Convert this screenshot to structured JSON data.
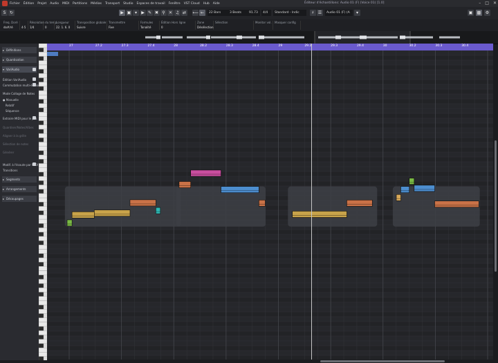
{
  "menu": {
    "items": [
      "Fichier",
      "Édition",
      "Projet",
      "Audio",
      "MIDI",
      "Partitions",
      "Médias",
      "Transport",
      "Studio",
      "Espaces de travail",
      "Fenêtre",
      "VST Cloud",
      "Hub",
      "Aide"
    ],
    "window_title": "Éditeur d'échantillons: Audio 01 (F) (Voice 01) [1.0]"
  },
  "toolbar": {
    "bars": "22 Bars",
    "beats": "3 Beats",
    "tempo": "91.73",
    "signature": "4/4",
    "scale": "Standard - Indic",
    "channel": "Audio 01 (F) (A"
  },
  "infoline": {
    "fields": [
      {
        "label": "Freq. Doré",
        "value": "do#/ré"
      },
      {
        "label": "",
        "value": "4·5"
      },
      {
        "label": "Résolution du temp",
        "value": "1/4"
      },
      {
        "label": "",
        "value": "0"
      },
      {
        "label": "Longueur",
        "value": "22. 1. 6. 0"
      },
      {
        "label": "Transposition globale",
        "value": "Suivre"
      },
      {
        "label": "Transmettre",
        "value": "Fixe"
      },
      {
        "label": "Formules",
        "value": "Tonalité"
      },
      {
        "label": "Édition Hors ligne",
        "value": "0"
      },
      {
        "label": "Zone",
        "value": "Désélection"
      },
      {
        "label": "Sélection",
        "value": ""
      },
      {
        "label": "Monitor vol.",
        "value": ""
      },
      {
        "label": "Masquer config",
        "value": ""
      }
    ]
  },
  "inspector": {
    "sections_top": [
      "Définitions",
      "Quantisation",
      "VariAudio"
    ],
    "variaudio_title": "Édition VariAudio",
    "variaudio_sub": "Commutation multi-édition",
    "smart_controls_label": "Mode Collage de Notes",
    "options": [
      "Manuelle",
      "Relatif",
      "Séquence"
    ],
    "extract_midi": "Extraire MIDI pour le pas",
    "dim_items": [
      "Quantiser/Notes/Vibes",
      "Aligner à la grille",
      "Sélection de notes",
      "Générer"
    ],
    "pitch_label": "Modif. à l'écoute par MIDI",
    "pitch_sub": "Transitions",
    "sections_bottom": [
      "Segments",
      "Arrangements",
      "Découpages"
    ]
  },
  "ruler": {
    "bar_labels": [
      "27",
      "27.2",
      "27.3",
      "27.4",
      "28",
      "28.2",
      "28.3",
      "28.4",
      "29",
      "29.2",
      "29.3",
      "29.4",
      "30",
      "30.2",
      "30.3",
      "30.4"
    ]
  },
  "colors": {
    "note_yellow": "#c8a34a",
    "note_orange": "#c97247",
    "note_pink": "#c94e9f",
    "note_blue": "#4d8ecf",
    "note_green": "#7ab945",
    "note_cyan": "#2fb8b4",
    "note_gold": "#d8a95a",
    "ruler_purple": "#6a5acd"
  },
  "notes": [
    {
      "color": "note_green",
      "start": 0.045,
      "length": 0.011,
      "pitch": 0.548
    },
    {
      "color": "note_yellow",
      "start": 0.056,
      "length": 0.05,
      "pitch": 0.522
    },
    {
      "color": "note_yellow",
      "start": 0.106,
      "length": 0.08,
      "pitch": 0.516
    },
    {
      "color": "note_orange",
      "start": 0.186,
      "length": 0.058,
      "pitch": 0.483
    },
    {
      "color": "note_cyan",
      "start": 0.244,
      "length": 0.01,
      "pitch": 0.508
    },
    {
      "color": "note_orange",
      "start": 0.296,
      "length": 0.026,
      "pitch": 0.424
    },
    {
      "color": "note_pink",
      "start": 0.322,
      "length": 0.068,
      "pitch": 0.387
    },
    {
      "color": "note_blue",
      "start": 0.39,
      "length": 0.085,
      "pitch": 0.44
    },
    {
      "color": "note_orange",
      "start": 0.475,
      "length": 0.014,
      "pitch": 0.484
    },
    {
      "color": "note_yellow",
      "start": 0.55,
      "length": 0.122,
      "pitch": 0.52
    },
    {
      "color": "note_orange",
      "start": 0.672,
      "length": 0.057,
      "pitch": 0.484
    },
    {
      "color": "note_gold",
      "start": 0.783,
      "length": 0.01,
      "pitch": 0.466
    },
    {
      "color": "note_blue",
      "start": 0.793,
      "length": 0.019,
      "pitch": 0.44
    },
    {
      "color": "note_green",
      "start": 0.812,
      "length": 0.011,
      "pitch": 0.413
    },
    {
      "color": "note_blue",
      "start": 0.823,
      "length": 0.046,
      "pitch": 0.436
    },
    {
      "color": "note_orange",
      "start": 0.869,
      "length": 0.099,
      "pitch": 0.487
    }
  ]
}
